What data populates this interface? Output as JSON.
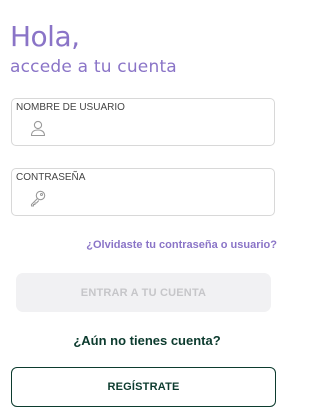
{
  "header": {
    "title": "Hola,",
    "subtitle": "accede a tu cuenta"
  },
  "form": {
    "username": {
      "label": "NOMBRE DE USUARIO",
      "value": "",
      "icon": "user-icon"
    },
    "password": {
      "label": "CONTRASEÑA",
      "value": "",
      "icon": "key-icon"
    },
    "forgot_link": "¿Olvidaste tu contraseña o usuario?",
    "login_button": "ENTRAR A TU CUENTA"
  },
  "register": {
    "prompt": "¿Aún no tienes cuenta?",
    "button": "REGÍSTRATE"
  },
  "colors": {
    "accent_purple": "#8a74c7",
    "dark_green": "#0c3b2e",
    "disabled_bg": "#f1f1f3",
    "disabled_text": "#c6c6c9",
    "border": "#d8d8d8"
  }
}
